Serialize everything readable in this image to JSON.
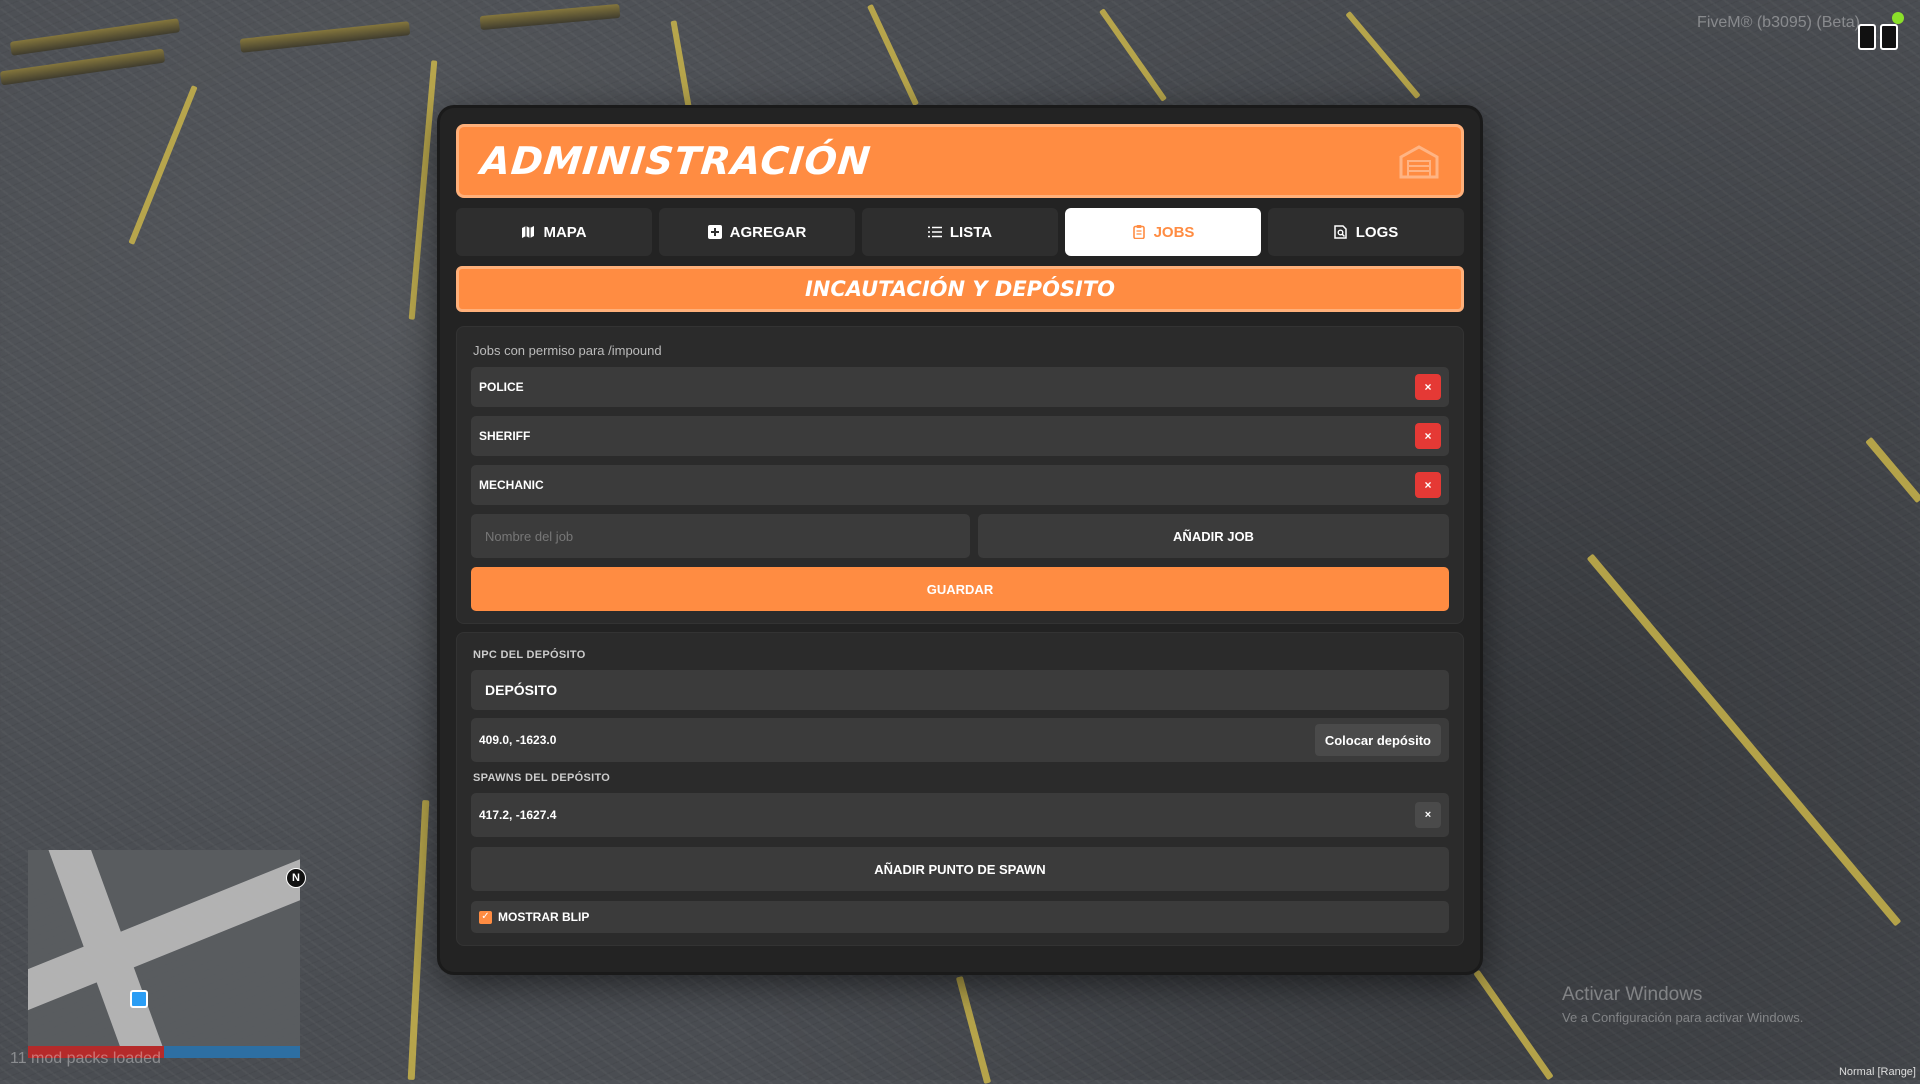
{
  "overlay": {
    "fivem_label": "FiveM® (b3095) (Beta)",
    "mod_packs": "11 mod packs loaded",
    "activate_title": "Activar Windows",
    "activate_sub": "Ve a Configuración para activar Windows.",
    "status_text": "Normal [Range]"
  },
  "colors": {
    "accent": "#ff8c42",
    "danger": "#e53935",
    "panel": "#232323"
  },
  "header": {
    "title": "ADMINISTRACIÓN",
    "icon": "garage-icon"
  },
  "tabs": [
    {
      "label": "MAPA",
      "icon": "map-icon"
    },
    {
      "label": "AGREGAR",
      "icon": "plus-square-icon"
    },
    {
      "label": "LISTA",
      "icon": "list-icon"
    },
    {
      "label": "JOBS",
      "icon": "clipboard-icon",
      "active": true
    },
    {
      "label": "LOGS",
      "icon": "file-search-icon"
    }
  ],
  "section": {
    "title": "INCAUTACIÓN Y DEPÓSITO"
  },
  "jobs_card": {
    "label": "Jobs con permiso para /impound",
    "jobs": [
      {
        "name": "POLICE",
        "remove": "×"
      },
      {
        "name": "SHERIFF",
        "remove": "×"
      },
      {
        "name": "MECHANIC",
        "remove": "×"
      }
    ],
    "input_placeholder": "Nombre del job",
    "input_value": "",
    "add_label": "AÑADIR JOB",
    "save_label": "GUARDAR"
  },
  "depot_card": {
    "npc_label": "NPC DEL DEPÓSITO",
    "npc_name": "DEPÓSITO",
    "npc_coords": "409.0, -1623.0",
    "place_label": "Colocar depósito",
    "spawns_label": "SPAWNS DEL DEPÓSITO",
    "spawns": [
      {
        "coords": "417.2, -1627.4",
        "remove": "×"
      }
    ],
    "add_spawn_label": "AÑADIR PUNTO DE SPAWN",
    "show_blip_label": "MOSTRAR BLIP",
    "show_blip_checked": true,
    "check_mark": "✓"
  },
  "minimap": {
    "compass": "N"
  }
}
